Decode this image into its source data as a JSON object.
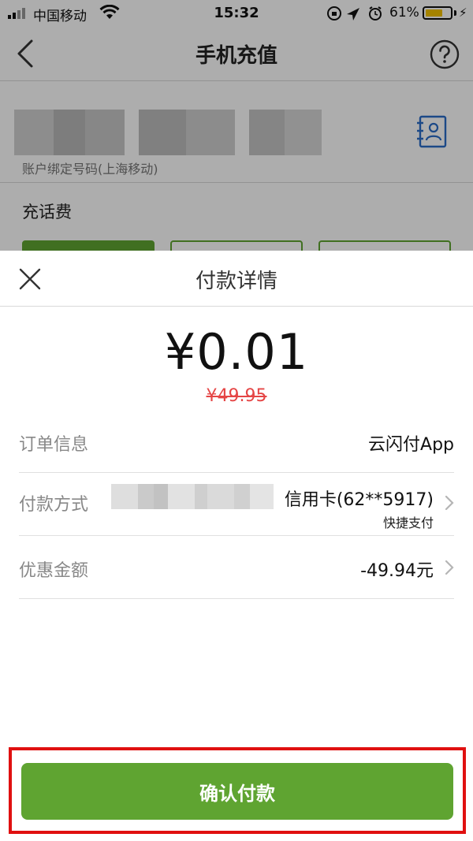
{
  "status_bar": {
    "carrier": "中国移动",
    "time": "15:32",
    "battery_percent": "61%",
    "icons": [
      "signal-icon",
      "wifi-icon",
      "orientation-lock-icon",
      "location-icon",
      "alarm-icon",
      "battery-icon",
      "charging-icon"
    ]
  },
  "nav": {
    "title": "手机充值",
    "back_icon": "back-icon",
    "help_icon": "help-icon"
  },
  "phone": {
    "number_masked": true,
    "caption": "账户绑定号码(上海移动)",
    "contact_icon": "contact-book-icon"
  },
  "charge": {
    "title": "充话费"
  },
  "sheet": {
    "title": "付款详情",
    "close_icon": "close-icon",
    "price": "¥0.01",
    "original_price": "¥49.95",
    "rows": [
      {
        "label": "订单信息",
        "value": "云闪付App"
      },
      {
        "label": "付款方式",
        "value": "信用卡(62**5917)",
        "sub": "快捷支付"
      },
      {
        "label": "优惠金额",
        "value": "-49.94元"
      }
    ],
    "confirm_label": "确认付款"
  },
  "colors": {
    "brand_green": "#5fa431",
    "strike_red": "#e54545",
    "highlight_red": "#e01010",
    "battery_yellow": "#f2c200"
  }
}
